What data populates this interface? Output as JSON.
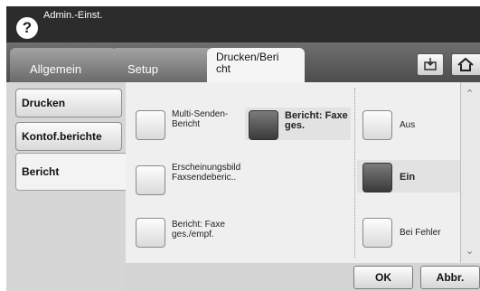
{
  "header": {
    "title": "Admin.-Einst.",
    "help_icon": "?"
  },
  "tabs": [
    {
      "label": "Allgemein"
    },
    {
      "label": "Setup"
    },
    {
      "label": "Drucken/Beri cht"
    }
  ],
  "toolbar_icons": [
    "job-status-icon",
    "home-icon"
  ],
  "sidebar": {
    "items": [
      {
        "label": "Drucken"
      },
      {
        "label": "Kontof.berichte"
      },
      {
        "label": "Bericht"
      }
    ]
  },
  "report_options": [
    {
      "label": "Multi-Senden-Bericht",
      "selected": false
    },
    {
      "label": "Bericht: Faxe ges.",
      "selected": true
    },
    {
      "label": "Erscheinungsbild Faxsendeberic..",
      "selected": false
    },
    {
      "label": "Bericht: Faxe ges./empf.",
      "selected": false
    }
  ],
  "setting_options": [
    {
      "label": "Aus",
      "selected": false
    },
    {
      "label": "Ein",
      "selected": true
    },
    {
      "label": "Bei Fehler",
      "selected": false
    }
  ],
  "footer": {
    "ok_label": "OK",
    "cancel_label": "Abbr."
  }
}
